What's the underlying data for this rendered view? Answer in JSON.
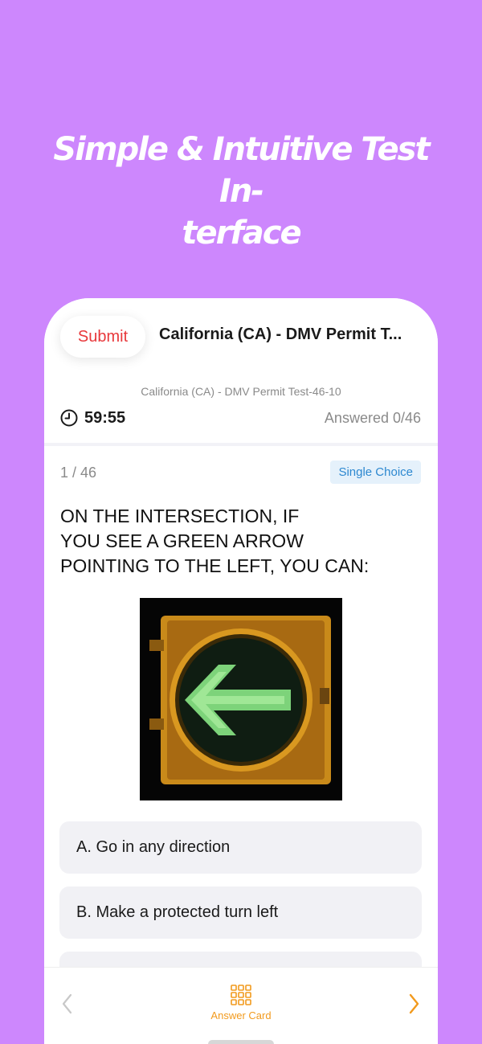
{
  "promo": {
    "headline": "Simple & Intuitive Test In-\nterface"
  },
  "header": {
    "submit_label": "Submit",
    "title": "California (CA) - DMV Permit T...",
    "subtitle": "California (CA) - DMV Permit Test-46-10",
    "timer": "59:55",
    "answered": "Answered 0/46"
  },
  "question": {
    "counter": "1 / 46",
    "type": "Single Choice",
    "text": "ON THE INTERSECTION,  IF\nYOU SEE A GREEN ARROW\nPOINTING TO THE LEFT, YOU CAN:",
    "image": "green-left-arrow-traffic-signal"
  },
  "options": [
    {
      "label": "A. Go in any direction"
    },
    {
      "label": "B. Make a protected turn left"
    },
    {
      "label": ""
    }
  ],
  "bottom_bar": {
    "answer_card_label": "Answer Card"
  },
  "colors": {
    "background": "#cd87fd",
    "submit": "#e8383b",
    "accent": "#f29a1d",
    "badge_text": "#2d88d0",
    "badge_bg": "#e5f1fb"
  }
}
